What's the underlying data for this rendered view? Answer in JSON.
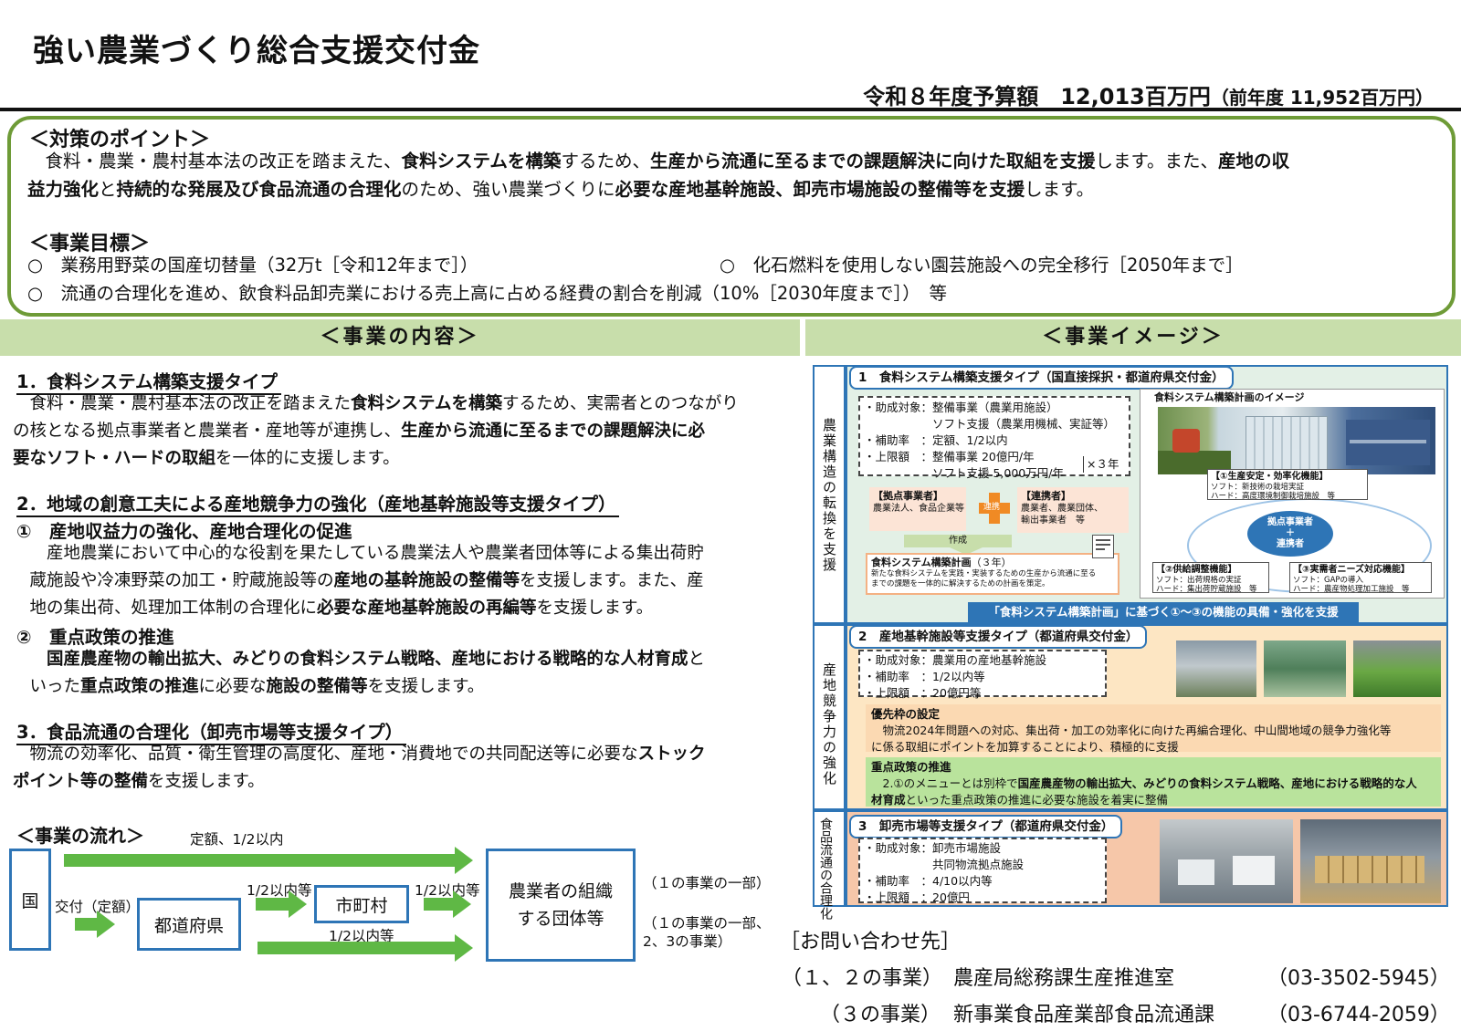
{
  "header": {
    "title": "強い農業づくり総合支援交付金",
    "budget": "令和８年度予算額　12,013百万円",
    "budget_prev": "（前年度 11,952百万円）"
  },
  "points": {
    "heading": "＜対策のポイント＞",
    "line1": {
      "s1": "　食料・農業・農村基本法の改正を踏まえた、",
      "b1": "食料システムを構築",
      "s2": "するため、",
      "b2": "生産から流通に至るまでの課題解決に向けた取組を支援",
      "s3": "します。また、",
      "b3": "産地の収"
    },
    "line2": {
      "b1": "益力強化",
      "s1": "と",
      "b2": "持続的な発展及び食品流通の合理化",
      "s2": "のため、強い農業づくりに",
      "b3": "必要な産地基幹施設、卸売市場施設の整備等を支援",
      "s3": "します。"
    },
    "goals_heading": "＜事業目標＞",
    "goal1": "○　業務用野菜の国産切替量（32万t［令和12年まで］）",
    "goal2": "○　化石燃料を使用しない園芸施設への完全移行［2050年まで］",
    "goal3": "○　流通の合理化を進め、飲食料品卸売業における売上高に占める経費の割合を削減（10%［2030年度まで］）　等"
  },
  "bars": {
    "content": "＜事業の内容＞",
    "image": "＜事業イメージ＞"
  },
  "content": {
    "h1": "1．食料システム構築支援タイプ",
    "p1a": {
      "s1": "　食料・農業・農村基本法の改正を踏まえた",
      "b1": "食料システムを構築",
      "s2": "するため、実需者とのつながり"
    },
    "p1b": {
      "s1": "の核となる拠点事業者と農業者・産地等が連携し、",
      "b1": "生産から流通に至るまでの課題解決に必"
    },
    "p1c": {
      "b1": "要なソフト・ハードの取組",
      "s1": "を一体的に支援します。"
    },
    "h2": "2．地域の創意工夫による産地競争力の強化（産地基幹施設等支援タイプ）",
    "h2_1": "①　産地収益力の強化、産地合理化の促進",
    "p2a": "　　産地農業において中心的な役割を果たしている農業法人や農業者団体等による集出荷貯",
    "p2b": {
      "s1": "　蔵施設や冷凍野菜の加工・貯蔵施設等の",
      "b1": "産地の基幹施設の整備等",
      "s2": "を支援します。また、産"
    },
    "p2c": {
      "s1": "　地の集出荷、処理加工体制の合理化に",
      "b1": "必要な産地基幹施設の再編等",
      "s2": "を支援します。"
    },
    "h2_2": "②　重点政策の推進",
    "p2d": {
      "b1": "　　国産農産物の輸出拡大、みどりの食料システム戦略、産地における戦略的な人材育成",
      "s1": "と"
    },
    "p2e": {
      "s1": "　いった",
      "b1": "重点政策の推進",
      "s2": "に必要な",
      "b2": "施設の整備等",
      "s3": "を支援します。"
    },
    "h3": "3．食品流通の合理化（卸売市場等支援タイプ）",
    "p3a": {
      "s1": "　物流の効率化、品質・衛生管理の高度化、産地・消費地での共同配送等に必要な",
      "b1": "ストック"
    },
    "p3b": {
      "b1": "ポイント等の整備",
      "s1": "を支援します。"
    }
  },
  "flow": {
    "heading": "＜事業の流れ＞",
    "top_label": "定額、1/2以内",
    "kuni": "国",
    "kofu": "交付（定額）",
    "todofuken": "都道府県",
    "to_shichoson": "1/2以内等",
    "shichoson": "市町村",
    "to_org": "1/2以内等",
    "org": "農業者の組織\nする団体等",
    "bottom_label": "1/2以内等",
    "note1": "（１の事業の一部）",
    "note2": "（１の事業の一部、",
    "note3": "2、3の事業）"
  },
  "contact": {
    "heading": "［お問い合わせ先］",
    "r1_label": "（１、２の事業）",
    "r1_dept": "農産局総務課生産推進室",
    "r1_tel": "（03-3502-5945）",
    "r2_label": "（３の事業）",
    "r2_dept": "新事業食品産業部食品流通課",
    "r2_tel": "（03-6744-2059）"
  },
  "image": {
    "side1": "農業構造の転換を支援",
    "side2": "産地競争力の強化",
    "side3": "食品流通の合理化",
    "t1_title": "1　食料システム構築支援タイプ（国直接採択・都道府県交付金）",
    "t1_l1": "・助成対象：整備事業（農業用施設）",
    "t1_l2": "　　　　　　ソフト支援（農業用機械、実証等）",
    "t1_l3": "・補助率　：定額、1/2以内",
    "t1_l4": "・上限額　：整備事業 20億円/年",
    "t1_l5": "　　　　　　ソフト支援 5,000万円/年",
    "t1_x3": "×３年",
    "kyoten_head": "【拠点事業者】",
    "kyoten_body": "農業法人、食品企業等",
    "renkei_head": "【連携者】",
    "renkei_body": "農業者、農業団体、\n輸出事業者　等",
    "renkei_mark": "連携",
    "sakusei": "作成",
    "plan_head": "食料システム構築計画",
    "plan_years": "（３年）",
    "plan_body": "新たな食料システムを実践・実装するための生産から流通に至る\nまでの課題を一体的に解決するための計画を策定。",
    "plan_img_title": "食料システム構築計画のイメージ",
    "func1_head": "【①生産安定・効率化機能】",
    "func1_body": "ソフト：新技術の栽培実証\nハード：高度環境制御栽培施設　等",
    "center": "拠点事業者\n＋\n連携者",
    "func2_head": "【②供給調整機能】",
    "func2_body": "ソフト：出荷規格の実証\nハード：集出荷貯蔵施設　等",
    "func3_head": "【③実需者ニーズ対応機能】",
    "func3_body": "ソフト：GAPの導入\nハード：農産物処理加工施設　等",
    "t1_footer": "「食料システム構築計画」に基づく①～③の機能の具備・強化を支援",
    "t2_title": "2　産地基幹施設等支援タイプ（都道府県交付金）",
    "t2_l1": "・助成対象：農業用の産地基幹施設",
    "t2_l2": "・補助率　：1/2以内等",
    "t2_l3": "・上限額　：20億円等",
    "prio_head": "優先枠の設定",
    "prio_l1": "　物流2024年問題への対応、集出荷・加工の効率化に向けた再編合理化、中山間地域の競争力強化等",
    "prio_l2": "に係る取組にポイントを加算することにより、積極的に支援",
    "focus_head": "重点政策の推進",
    "focus_l1a": "　2.①のメニューとは別枠で",
    "focus_l1b": "国産農産物の輸出拡大、みどりの食料システム戦略、産地における戦略的な人",
    "focus_l2a": "材育成",
    "focus_l2b": "といった重点政策の推進に必要な施設を着実に整備",
    "t3_title": "3　卸売市場等支援タイプ（都道府県交付金）",
    "t3_l1": "・助成対象：卸売市場施設",
    "t3_l2": "　　　　　　共同物流拠点施設",
    "t3_l3": "・補助率　：4/10以内等",
    "t3_l4": "・上限額　：20億円"
  },
  "colors": {
    "green_border": "#6e9b37",
    "section_bar": "#c8deab",
    "arrow_green": "#5fb845",
    "flow_blue": "#2e75b6",
    "type1_bg": "#e3f0e6",
    "type2_bg": "#fde6c3",
    "type3_bg": "#f6c7a9",
    "focus_bg": "#b9e39c",
    "footer_blue": "#2e75b6"
  }
}
